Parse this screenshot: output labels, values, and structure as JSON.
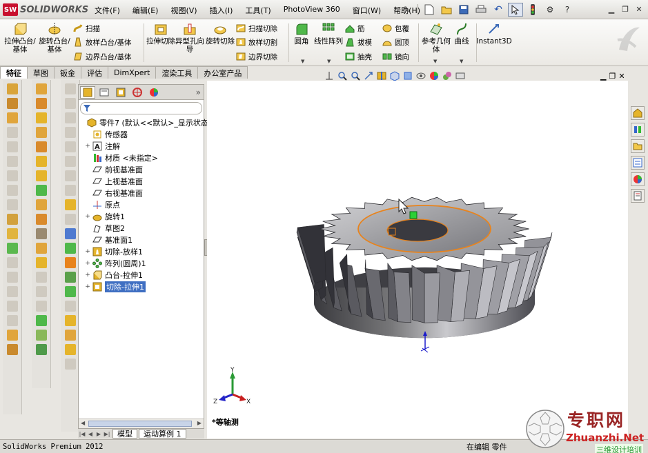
{
  "app": {
    "logo_text": "SOLIDWORKS",
    "logo_mark": "SW"
  },
  "menu": [
    "文件(F)",
    "编辑(E)",
    "视图(V)",
    "插入(I)",
    "工具(T)",
    "PhotoView 360",
    "窗口(W)",
    "帮助(H)"
  ],
  "ribbon": {
    "extrude_boss": "拉伸凸台/基体",
    "revolve_boss": "旋转凸台/基体",
    "sweep": "扫描",
    "loft_boss": "放样凸台/基体",
    "boundary_boss": "边界凸台/基体",
    "extrude_cut": "拉伸切除",
    "hole_wizard": "异型孔向导",
    "revolve_cut": "旋转切除",
    "swept_cut": "扫描切除",
    "lofted_cut": "放样切割",
    "boundary_cut": "边界切除",
    "fillet": "圆角",
    "linear_pattern": "线性阵列",
    "rib": "筋",
    "draft": "拔模",
    "shell": "抽壳",
    "wrap": "包覆",
    "dome": "圆顶",
    "mirror": "镜向",
    "ref_geometry": "参考几何体",
    "curves": "曲线",
    "instant3d": "Instant3D"
  },
  "command_tabs": [
    "特征",
    "草图",
    "钣金",
    "评估",
    "DimXpert",
    "渲染工具",
    "办公室产品"
  ],
  "feature_tree": {
    "root": "零件7  (默认<<默认>_显示状态",
    "items": [
      {
        "label": "传感器",
        "expand": "",
        "icon": "sensor-icon"
      },
      {
        "label": "注解",
        "expand": "+",
        "icon": "annotation-icon"
      },
      {
        "label": "材质 <未指定>",
        "expand": "",
        "icon": "material-icon"
      },
      {
        "label": "前视基准面",
        "expand": "",
        "icon": "plane-icon"
      },
      {
        "label": "上视基准面",
        "expand": "",
        "icon": "plane-icon"
      },
      {
        "label": "右视基准面",
        "expand": "",
        "icon": "plane-icon"
      },
      {
        "label": "原点",
        "expand": "",
        "icon": "origin-icon"
      },
      {
        "label": "旋转1",
        "expand": "+",
        "icon": "revolve-icon"
      },
      {
        "label": "草图2",
        "expand": "",
        "icon": "sketch-icon"
      },
      {
        "label": "基准面1",
        "expand": "",
        "icon": "plane-icon"
      },
      {
        "label": "切除-放样1",
        "expand": "+",
        "icon": "cut-loft-icon"
      },
      {
        "label": "阵列(圆周)1",
        "expand": "+",
        "icon": "circular-pattern-icon"
      },
      {
        "label": "凸台-拉伸1",
        "expand": "+",
        "icon": "boss-extrude-icon"
      },
      {
        "label": "切除-拉伸1",
        "expand": "+",
        "icon": "cut-extrude-icon",
        "selected": true
      }
    ]
  },
  "bottom_tabs": [
    "模型",
    "运动算例 1"
  ],
  "viewport": {
    "view_name": "*等轴测",
    "axes": {
      "x": "X",
      "y": "Y",
      "z": "Z"
    }
  },
  "status": {
    "product": "SolidWorks Premium 2012",
    "mode": "在编辑 零件"
  },
  "watermark": {
    "title": "专职网",
    "url": "Zhuanzhi.Net",
    "tag": "三维设计培训"
  },
  "colors": {
    "selection_orange": "#e8831c",
    "title_red": "#c8102e",
    "tree_select": "#3f6fc2"
  }
}
